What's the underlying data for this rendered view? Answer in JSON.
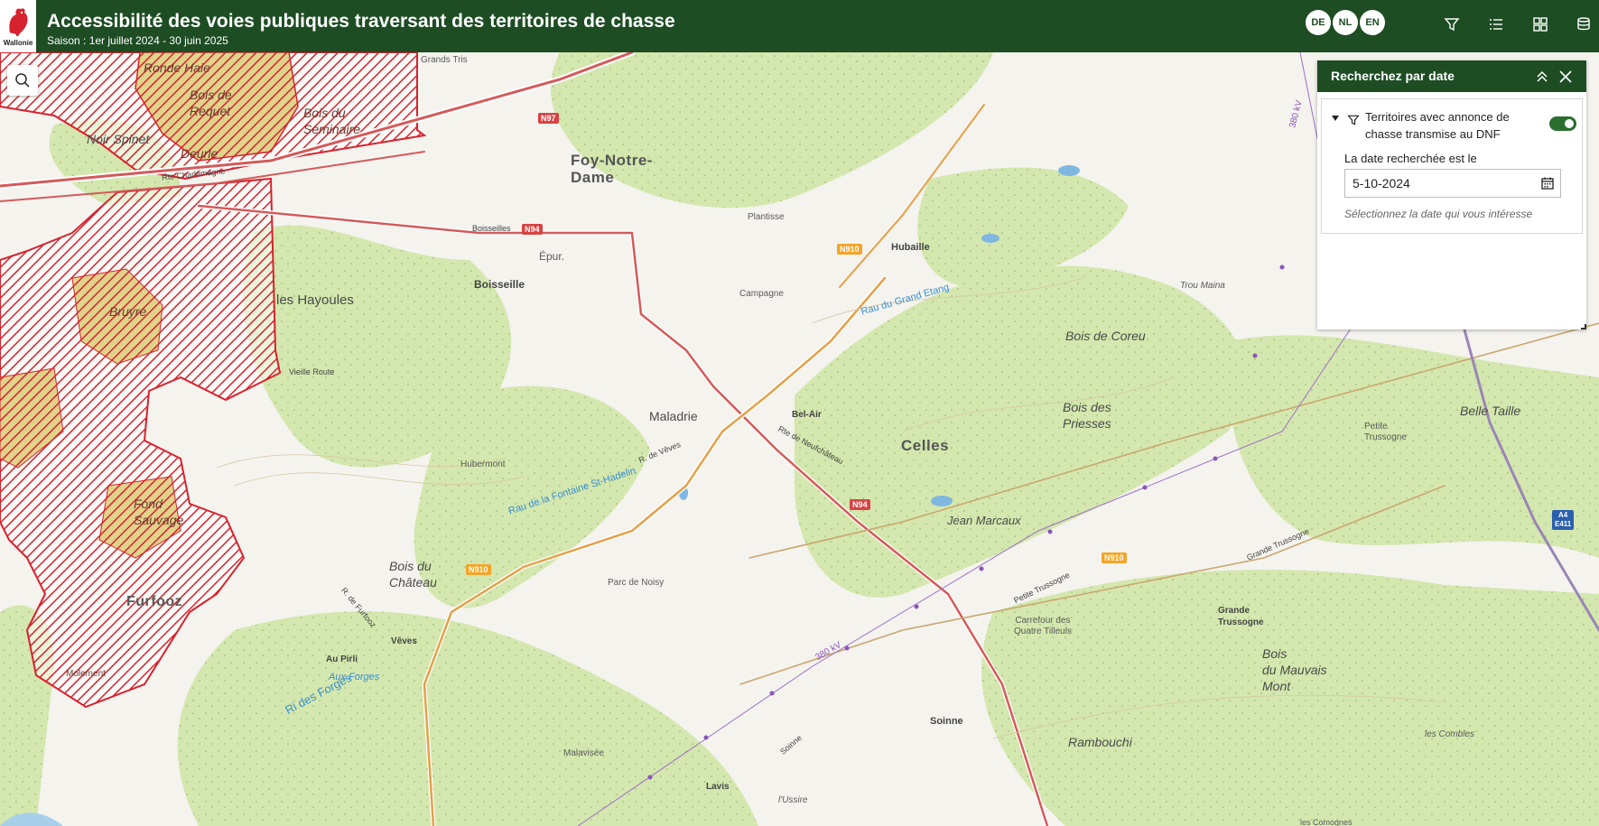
{
  "header": {
    "title": "Accessibilité des voies publiques traversant des territoires de chasse",
    "subtitle": "Saison : 1er juillet 2024 - 30 juin 2025",
    "logo_text": "Wallonie",
    "languages": [
      "DE",
      "NL",
      "EN"
    ],
    "toolbar": [
      "filter-icon",
      "list-icon",
      "grid-icon",
      "layers-icon"
    ]
  },
  "panel": {
    "title": "Recherchez par date",
    "filter_label": "Territoires avec annonce de chasse transmise au DNF",
    "filter_enabled": true,
    "date_label": "La date recherchée est le",
    "date_value": "5-10-2024",
    "hint": "Sélectionnez la date qui vous intéresse"
  },
  "map_labels": {
    "foy": "Foy-Notre-\nDame",
    "celles": "Celles",
    "boisseille": "Boisseille",
    "boisseilles_road": "Boisseilles",
    "epur": "Épur.",
    "hubaille": "Hubaille",
    "plantisse": "Plantisse",
    "campagne": "Campagne",
    "hayoules": "les Hayoules",
    "maladrie": "Maladrie",
    "belair": "Bel-Air",
    "hubermont": "Hubermont",
    "bois_coreu": "Bois de Coreu",
    "bois_priesses": "Bois des\nPriesses",
    "jean_marcaux": "Jean Marcaux",
    "belle_taille": "Belle Taille",
    "petite_trussogne": "Petite\nTrussogne",
    "grande_trussogne": "Grande\nTrussogne",
    "trou_maina": "Trou Maina",
    "bois_chateau": "Bois du\nChâteau",
    "parc_noisy": "Parc de Noisy",
    "carrefour": "Carrefour des\nQuatre Tilleuls",
    "bois_mauvais_mont": "Bois\ndu Mauvais\nMont",
    "soinne": "Soinne",
    "rambouchi": "Rambouchi",
    "furfooz": "Furfooz",
    "veves": "Vêves",
    "au_pirli": "Au Pirli",
    "aux_forges": "Aux Forges",
    "malavisee": "Malavisée",
    "lavis": "Lavis",
    "lussire": "l'Ussire",
    "les_combles": "les Combles",
    "les_comognes": "les Comognes",
    "fond_sauvage": "Fond\nSauvage",
    "bruyre": "Bruyre",
    "noir_spinet": "Noir Spinet",
    "ronde_haie": "Ronde Haie",
    "bois_requet": "Bois de\nRequet",
    "bois_seminaire": "Bois du\nSéminaire",
    "deurle": "Deurle",
    "molement": "Molement",
    "grands_tris": "Grands Tris",
    "vieille_route": "Vieille Route",
    "rau_grand_etang": "Rau du Grand Etang",
    "rau_fontaine": "Rau de la Fontaine St-Hadelin",
    "ri_forges": "Ri des Forges",
    "kv380": "380 kV",
    "kv380b": "380 kV",
    "rte_charlemagne": "Rte Charlemagne",
    "rte_neufchateau": "Rte de Neufchâteau",
    "rte_veves": "R. de Vêves",
    "grande_trussogne_rd": "Grande Trussogne",
    "petite_trussogne_rd": "Petite Trussogne",
    "soinne_rd": "Soinne",
    "rte_furfooz": "R. de Furfooz"
  },
  "road_shields": {
    "n97": "N97",
    "n94a": "N94",
    "n94b": "N94",
    "n910a": "N910",
    "n910b": "N910",
    "n910c": "N910",
    "a4": "A4\nE411"
  },
  "colors": {
    "header": "#1e4d24",
    "hunting_zone": "#d7222f",
    "forest": "#cfe2a6",
    "toggle_on": "#2a6e30"
  }
}
